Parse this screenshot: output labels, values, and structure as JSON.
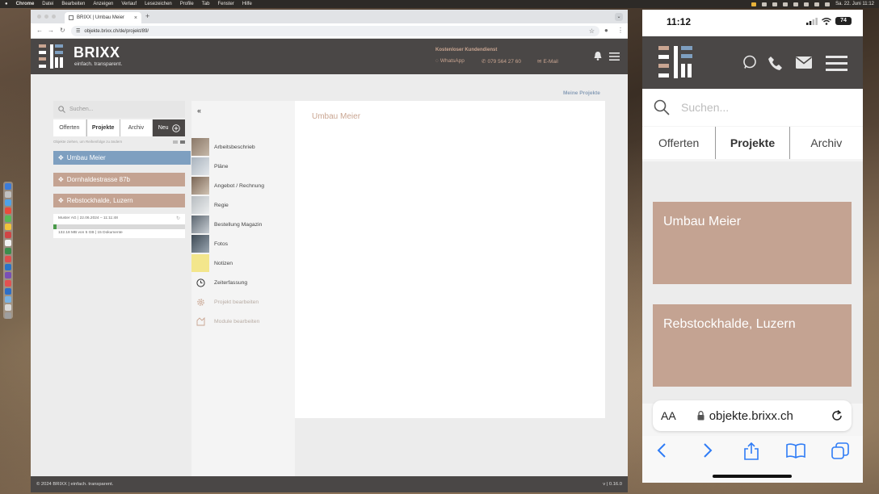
{
  "menubar": {
    "app": "Chrome",
    "items": [
      "Datei",
      "Bearbeiten",
      "Anzeigen",
      "Verlauf",
      "Lesezeichen",
      "Profile",
      "Tab",
      "Fenster",
      "Hilfe"
    ],
    "clock": "Sa. 22. Juni  11:12"
  },
  "browser": {
    "tab_title": "BRIXX | Umbau Meier",
    "url": "objekte.brixx.ch/de/projekt/89/"
  },
  "site": {
    "brand": "BRIXX",
    "tagline": "einfach. transparent.",
    "service_title": "Kostenloser Kundendienst",
    "whatsapp": "WhatsApp",
    "phone": "079 564 27 60",
    "email": "E-Mail",
    "my_projects": "Meine Projekte",
    "search_placeholder": "Suchen...",
    "tabs": {
      "offers": "Offerten",
      "projects": "Projekte",
      "archive": "Archiv",
      "new": "Neu"
    },
    "drag_note": "Objekte ziehen, um Reihenfolge zu ändern",
    "projects": [
      {
        "name": "Umbau Meier"
      },
      {
        "name": "Dornhaldestrasse 87b"
      },
      {
        "name": "Rebstockhalde, Luzern"
      }
    ],
    "storage": {
      "info": "Muster AG | 22.06.2024 – 11:11:48",
      "usage": "132.18 MB von 5 GB | 15 Dokumente",
      "used_fraction": 0.026
    },
    "menu": {
      "items": [
        {
          "label": "Arbeitsbeschrieb",
          "icon": "work-description-thumbnail"
        },
        {
          "label": "Pläne",
          "icon": "plans-thumbnail"
        },
        {
          "label": "Angebot / Rechnung",
          "icon": "offer-invoice-thumbnail"
        },
        {
          "label": "Regie",
          "icon": "regie-thumbnail"
        },
        {
          "label": "Bestellung Magazin",
          "icon": "order-thumbnail"
        },
        {
          "label": "Fotos",
          "icon": "photos-thumbnail"
        },
        {
          "label": "Notizen",
          "icon": "notes-thumbnail"
        },
        {
          "label": "Zeiterfassung",
          "icon": "clock-icon"
        },
        {
          "label": "Projekt bearbeiten",
          "icon": "gear-icon"
        },
        {
          "label": "Module bearbeiten",
          "icon": "puzzle-icon"
        }
      ]
    },
    "project_title": "Umbau Meier",
    "footer": "© 2024 BRIXX | einfach. transparent.",
    "version": "v | 0.16.0"
  },
  "phone": {
    "time": "11:12",
    "battery": "74",
    "search_placeholder": "Suchen...",
    "tabs": {
      "offers": "Offerten",
      "projects": "Projekte",
      "archive": "Archiv"
    },
    "cards": [
      "Umbau Meier",
      "Rebstockhalde, Luzern"
    ],
    "aa": "AA",
    "url": "objekte.brixx.ch"
  },
  "colors": {
    "header": "#4a4746",
    "project_card": "#c4a392",
    "project_active": "#7e9fc0",
    "accent_text": "#c9a591"
  }
}
